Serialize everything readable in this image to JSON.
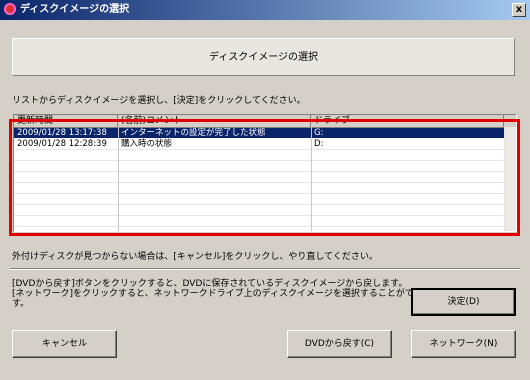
{
  "window": {
    "title": "ディスクイメージの選択",
    "close_glyph": "x"
  },
  "banner": {
    "text": "ディスクイメージの選択"
  },
  "instruction": "リストからディスクイメージを選択し、[決定]をクリックしてください。",
  "list": {
    "columns": [
      "更新時間",
      "(名前)コメント",
      "ドライブ"
    ],
    "rows": [
      {
        "time": "2009/01/28 13:17:38",
        "comment": "インターネットの設定が完了した状態",
        "drive": "G:",
        "selected": true
      },
      {
        "time": "2009/01/28 12:28:39",
        "comment": "購入時の状態",
        "drive": "D:",
        "selected": false
      }
    ]
  },
  "notes": {
    "external_disk": "外付けディスクが見つからない場合は、[キャンセル]をクリックし、やり直してください。",
    "dvd_line1": "[DVDから戻す]ボタンをクリックすると、DVDに保存されているディスクイメージから戻します。",
    "network_line1": "[ネットワーク]をクリックすると、ネットワークドライブ上のディスクイメージを選択することができま",
    "network_line2": "す。"
  },
  "buttons": {
    "decide": "決定(D)",
    "cancel": "キャンセル",
    "dvd": "DVDから戻す(C)",
    "network": "ネットワーク(N)"
  },
  "colors": {
    "title_bar_start": "#0a246a",
    "title_bar_end": "#a6caf0",
    "highlight_frame": "#e00000",
    "selection": "#0a246a"
  }
}
